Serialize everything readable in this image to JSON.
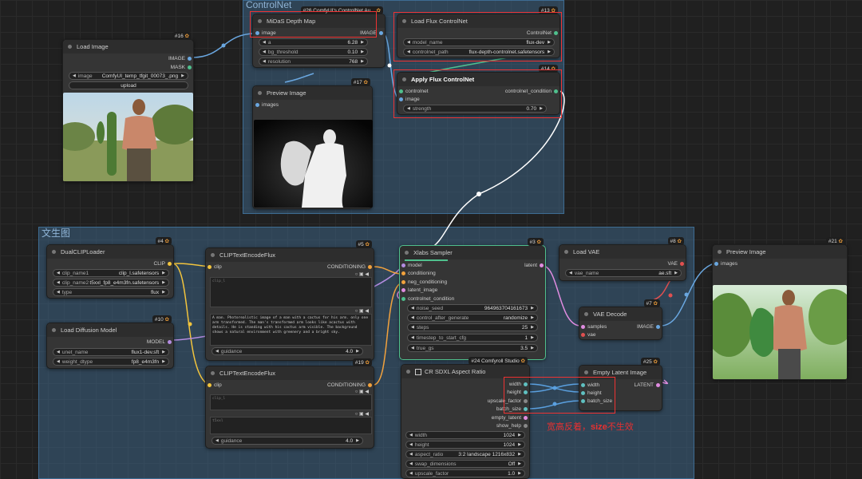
{
  "groups": {
    "controlnet": "ControlNet",
    "text2img": "文生图"
  },
  "nodes": {
    "load_image": {
      "id": "#16",
      "title": "Load Image",
      "outputs": [
        "IMAGE",
        "MASK"
      ],
      "image_label": "image",
      "image_value": "ComfyUI_temp_tfgit_00073_.png",
      "upload": "upload"
    },
    "midas": {
      "id": "#26 ComfyUI's ControlNet Au...",
      "title": "MiDaS Depth Map",
      "input": "image",
      "output": "IMAGE",
      "widgets": [
        {
          "label": "a",
          "value": "6.28"
        },
        {
          "label": "bg_threshold",
          "value": "0.10"
        },
        {
          "label": "resolution",
          "value": "768"
        }
      ]
    },
    "preview_depth": {
      "id": "#17",
      "title": "Preview Image",
      "input": "images"
    },
    "load_flux_cn": {
      "id": "#13",
      "title": "Load Flux ControlNet",
      "output": "ControlNet",
      "widgets": [
        {
          "label": "model_name",
          "value": "flux-dev"
        },
        {
          "label": "controlnet_path",
          "value": "flux-depth-controlnet.safetensors"
        }
      ]
    },
    "apply_flux_cn": {
      "id": "#14",
      "title": "Apply Flux ControlNet",
      "inputs": [
        "controlnet",
        "image"
      ],
      "output": "controlnet_condition",
      "widgets": [
        {
          "label": "strength",
          "value": "0.70"
        }
      ]
    },
    "dual_clip": {
      "id": "#4",
      "title": "DualCLIPLoader",
      "output": "CLIP",
      "widgets": [
        {
          "label": "clip_name1",
          "value": "clip_l.safetensors"
        },
        {
          "label": "clip_name2",
          "value": "t5xxl_fp8_e4m3fn.safetensors"
        },
        {
          "label": "type",
          "value": "flux"
        }
      ]
    },
    "load_diffusion": {
      "id": "#10",
      "title": "Load Diffusion Model",
      "output": "MODEL",
      "widgets": [
        {
          "label": "unet_name",
          "value": "flux1-dev.sft"
        },
        {
          "label": "weight_dtype",
          "value": "fp8_e4m3fn"
        }
      ]
    },
    "clip_text_pos": {
      "id": "#5",
      "title": "CLIPTextEncodeFlux",
      "input": "clip",
      "output": "CONDITIONING",
      "clip_l_placeholder": "clip_l",
      "t5xxl_text": "A man. Photorealistic image of a man with a cactus for his arm. only one arm transformed. The man's transformed arm looks like acactus with details. He is standing with his cactus arm visible. The background shows a natural environment with greenery and a bright sky.",
      "guidance_label": "guidance",
      "guidance_value": "4.0"
    },
    "clip_text_neg": {
      "id": "#19",
      "title": "CLIPTextEncodeFlux",
      "input": "clip",
      "output": "CONDITIONING",
      "clip_l_placeholder": "clip_l",
      "t5xxl_placeholder": "t5xxl",
      "guidance_label": "guidance",
      "guidance_value": "4.0"
    },
    "xlabs_sampler": {
      "id": "#3",
      "title": "Xlabs Sampler",
      "inputs": [
        "model",
        "conditioning",
        "neg_conditioning",
        "latent_image",
        "controlnet_condition"
      ],
      "output": "latent",
      "widgets": [
        {
          "label": "noise_seed",
          "value": "964963704161673"
        },
        {
          "label": "control_after_generate",
          "value": "randomize"
        },
        {
          "label": "steps",
          "value": "25"
        },
        {
          "label": "timestep_to_start_cfg",
          "value": "1"
        },
        {
          "label": "true_gs",
          "value": "3.5"
        }
      ]
    },
    "load_vae": {
      "id": "#8",
      "title": "Load VAE",
      "output": "VAE",
      "widgets": [
        {
          "label": "vae_name",
          "value": "ae.sft"
        }
      ]
    },
    "vae_decode": {
      "id": "#7",
      "title": "VAE Decode",
      "inputs": [
        "samples",
        "vae"
      ],
      "output": "IMAGE"
    },
    "preview_final": {
      "id": "#21",
      "title": "Preview Image",
      "input": "images"
    },
    "cr_aspect": {
      "id": "#24 Comfyroll Studio",
      "title": "CR SDXL Aspect Ratio",
      "outputs": [
        "width",
        "height",
        "upscale_factor",
        "batch_size",
        "empty_latent",
        "show_help"
      ],
      "widgets": [
        {
          "label": "width",
          "value": "1024"
        },
        {
          "label": "height",
          "value": "1024"
        },
        {
          "label": "aspect_ratio",
          "value": "3:2 landscape 1216x832"
        },
        {
          "label": "swap_dimensions",
          "value": "Off"
        },
        {
          "label": "upscale_factor",
          "value": "1.0"
        }
      ]
    },
    "empty_latent": {
      "id": "#25",
      "title": "Empty Latent Image",
      "inputs": [
        "width",
        "height",
        "batch_size"
      ],
      "output": "LATENT"
    }
  },
  "annotation": {
    "prefix": "宽高反着，",
    "bold": "size",
    "suffix": "不生效"
  },
  "colors": {
    "annotation": "#e83030",
    "group": "#3d6384"
  }
}
